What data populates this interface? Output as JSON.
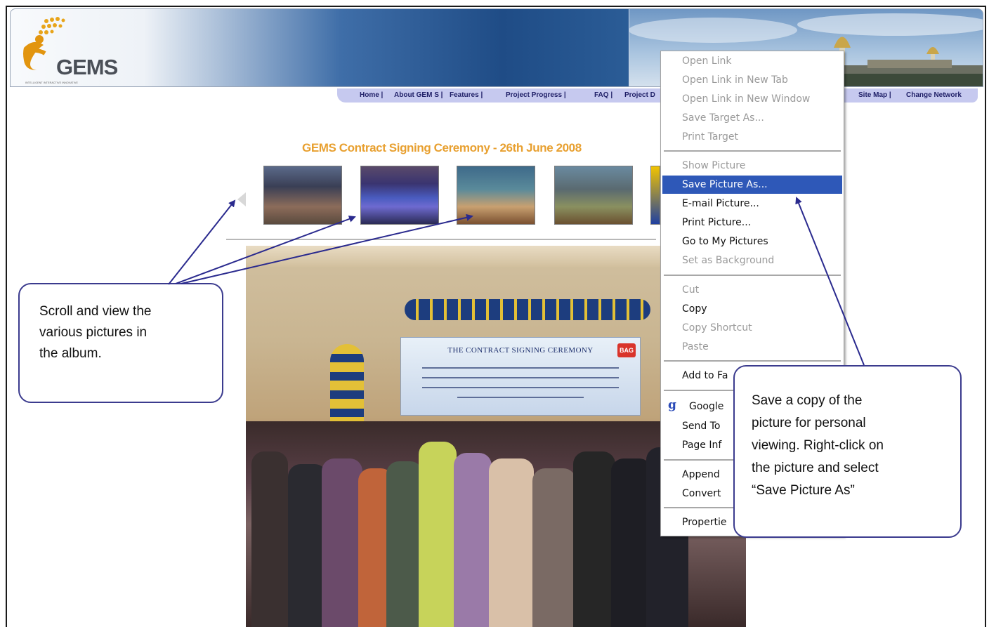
{
  "header": {
    "logo_text": "GEMS",
    "logo_tagline": "INTELLIGENT INTERACTIVE INNOVATIVE"
  },
  "nav": {
    "items": [
      "Home |",
      "About GEM S |",
      "Features |",
      "Project Progress |",
      "FAQ |",
      "Project D",
      "Site Map |",
      "Change Network"
    ]
  },
  "album": {
    "title": "GEMS Contract Signing Ceremony - 26th June 2008"
  },
  "photo": {
    "banner_title": "THE CONTRACT SIGNING CEREMONY",
    "banner_logo": "BAG"
  },
  "context_menu": {
    "items": [
      {
        "label": "Open Link",
        "state": "disabled"
      },
      {
        "label": "Open Link in New Tab",
        "state": "disabled"
      },
      {
        "label": "Open Link in New Window",
        "state": "disabled"
      },
      {
        "label": "Save Target As...",
        "state": "disabled"
      },
      {
        "label": "Print Target",
        "state": "disabled"
      },
      {
        "label": "Show Picture",
        "state": "disabled"
      },
      {
        "label": "Save Picture As...",
        "state": "highlighted"
      },
      {
        "label": "E-mail Picture...",
        "state": "enabled"
      },
      {
        "label": "Print Picture...",
        "state": "enabled"
      },
      {
        "label": "Go to My Pictures",
        "state": "enabled"
      },
      {
        "label": "Set as Background",
        "state": "disabled"
      },
      {
        "label": "Cut",
        "state": "disabled"
      },
      {
        "label": "Copy",
        "state": "enabled"
      },
      {
        "label": "Copy Shortcut",
        "state": "disabled"
      },
      {
        "label": "Paste",
        "state": "disabled"
      },
      {
        "label": "Add to Fa",
        "state": "enabled"
      },
      {
        "label": "Google",
        "state": "enabled"
      },
      {
        "label": "Send To",
        "state": "enabled"
      },
      {
        "label": "Page Inf",
        "state": "enabled"
      },
      {
        "label": "Append",
        "state": "enabled"
      },
      {
        "label": "Convert",
        "state": "enabled"
      },
      {
        "label": "Propertie",
        "state": "enabled"
      }
    ],
    "google_icon": "g"
  },
  "callouts": {
    "left": [
      "Scroll and view the",
      "various pictures in",
      "the album."
    ],
    "right": [
      "Save a copy of the",
      "picture for personal",
      "viewing. Right-click on",
      "the picture and select",
      "“Save Picture As”"
    ]
  },
  "colors": {
    "accent_title": "#e8a030",
    "menu_highlight": "#2e58b8",
    "callout_border": "#3b3b8e",
    "navbar_bg": "#c6c9ef"
  }
}
